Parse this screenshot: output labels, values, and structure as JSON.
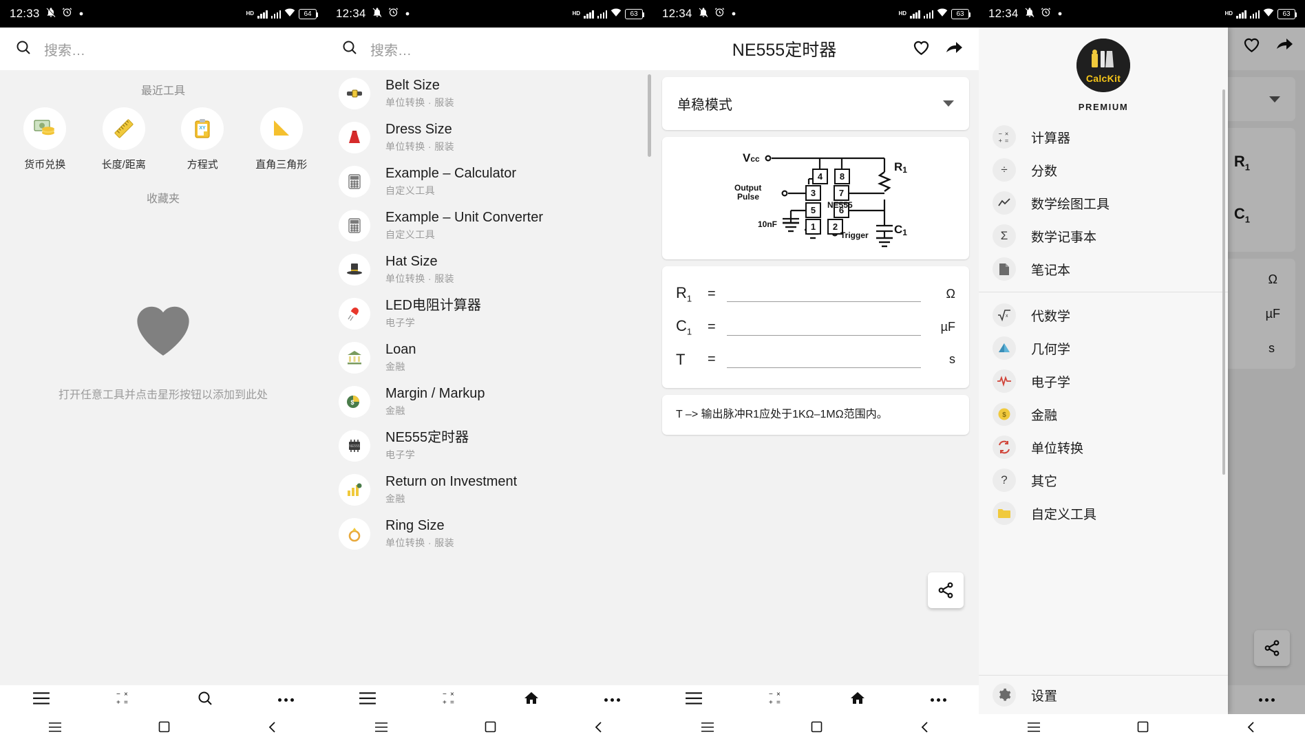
{
  "panels": [
    {
      "status": {
        "time": "12:33",
        "battery": "64",
        "hd": "HD"
      },
      "search_placeholder": "搜索…",
      "recent_label": "最近工具",
      "favorites_label": "收藏夹",
      "recent_tools": [
        {
          "name": "货币兑换",
          "icon": "money-icon"
        },
        {
          "name": "长度/距离",
          "icon": "ruler-icon"
        },
        {
          "name": "方程式",
          "icon": "clipboard-xy-icon"
        },
        {
          "name": "直角三角形",
          "icon": "triangle-icon"
        }
      ],
      "empty_text": "打开任意工具并点击星形按钮以添加到此处"
    },
    {
      "status": {
        "time": "12:34",
        "battery": "63",
        "hd": "HD"
      },
      "search_placeholder": "搜索…",
      "items": [
        {
          "title": "Belt Size",
          "sub": "单位转换 · 服装",
          "icon": "belt-icon"
        },
        {
          "title": "Dress Size",
          "sub": "单位转换 · 服装",
          "icon": "dress-icon"
        },
        {
          "title": "Example – Calculator",
          "sub": "自定义工具",
          "icon": "calculator-icon"
        },
        {
          "title": "Example – Unit Converter",
          "sub": "自定义工具",
          "icon": "calculator-icon"
        },
        {
          "title": "Hat Size",
          "sub": "单位转换 · 服装",
          "icon": "hat-icon"
        },
        {
          "title": "LED电阻计算器",
          "sub": "电子学",
          "icon": "led-icon"
        },
        {
          "title": "Loan",
          "sub": "金融",
          "icon": "bank-icon"
        },
        {
          "title": "Margin / Markup",
          "sub": "金融",
          "icon": "piechart-money-icon"
        },
        {
          "title": "NE555定时器",
          "sub": "电子学",
          "icon": "chip-icon"
        },
        {
          "title": "Return on Investment",
          "sub": "金融",
          "icon": "growth-icon"
        },
        {
          "title": "Ring Size",
          "sub": "单位转换 · 服装",
          "icon": "ring-icon"
        }
      ]
    },
    {
      "status": {
        "time": "12:34",
        "battery": "63",
        "hd": "HD"
      },
      "title": "NE555定时器",
      "mode": "单稳模式",
      "circuit": {
        "vcc": "Vcc",
        "output": "Output\nPulse",
        "output_line1": "Output",
        "output_line2": "Pulse",
        "chip": "NE555",
        "cap_in": "10nF",
        "trigger": "Trigger",
        "r1": "R",
        "r1_sub": "1",
        "c1": "C",
        "c1_sub": "1",
        "pins": [
          "4",
          "8",
          "3",
          "7",
          "5",
          "6",
          "1",
          "2"
        ]
      },
      "fields": [
        {
          "sym": "R",
          "sub": "1",
          "eq": "=",
          "value": "",
          "unit": "Ω"
        },
        {
          "sym": "C",
          "sub": "1",
          "eq": "=",
          "value": "",
          "unit": "µF"
        },
        {
          "sym": "T",
          "sub": "",
          "eq": "=",
          "value": "",
          "unit": "s"
        }
      ],
      "hint": "T –> 输出脉冲R1应处于1KΩ–1MΩ范围内。"
    },
    {
      "status": {
        "time": "12:34",
        "battery": "63",
        "hd": "HD"
      },
      "drawer": {
        "logo_text": "CalcKit",
        "premium": "PREMIUM",
        "items": [
          {
            "label": "计算器",
            "icon": "calc-ops-icon"
          },
          {
            "label": "分数",
            "icon": "divide-icon"
          },
          {
            "label": "数学绘图工具",
            "icon": "graph-icon"
          },
          {
            "label": "数学记事本",
            "icon": "sigma-icon"
          },
          {
            "label": "笔记本",
            "icon": "note-icon"
          }
        ],
        "items2": [
          {
            "label": "代数学",
            "icon": "sqrt-icon"
          },
          {
            "label": "几何学",
            "icon": "geometry-icon"
          },
          {
            "label": "电子学",
            "icon": "electronics-icon"
          },
          {
            "label": "金融",
            "icon": "finance-icon"
          },
          {
            "label": "单位转换",
            "icon": "convert-icon"
          },
          {
            "label": "其它",
            "icon": "question-icon"
          },
          {
            "label": "自定义工具",
            "icon": "folder-icon"
          }
        ],
        "settings": {
          "label": "设置",
          "icon": "gear-icon"
        }
      },
      "behind_fields": [
        {
          "sym": "R",
          "sub": "1",
          "unit": "Ω"
        },
        {
          "sym": "C",
          "sub": "1",
          "unit": "µF"
        },
        {
          "sym": "",
          "sub": "",
          "unit": "s"
        }
      ]
    }
  ],
  "bottom_nav": {
    "menu": "menu-icon",
    "ops": "calc-ops-icon",
    "search": "search-icon",
    "home": "home-icon",
    "more": "more-icon"
  },
  "system_nav": {
    "recents": "recents-icon",
    "home": "home-square-icon",
    "back": "back-icon"
  },
  "colors": {
    "accent": "#f5c518",
    "bg": "#f2f2f2",
    "surface": "#ffffff",
    "text": "#1c1c1c",
    "muted": "#9b9b9b"
  }
}
